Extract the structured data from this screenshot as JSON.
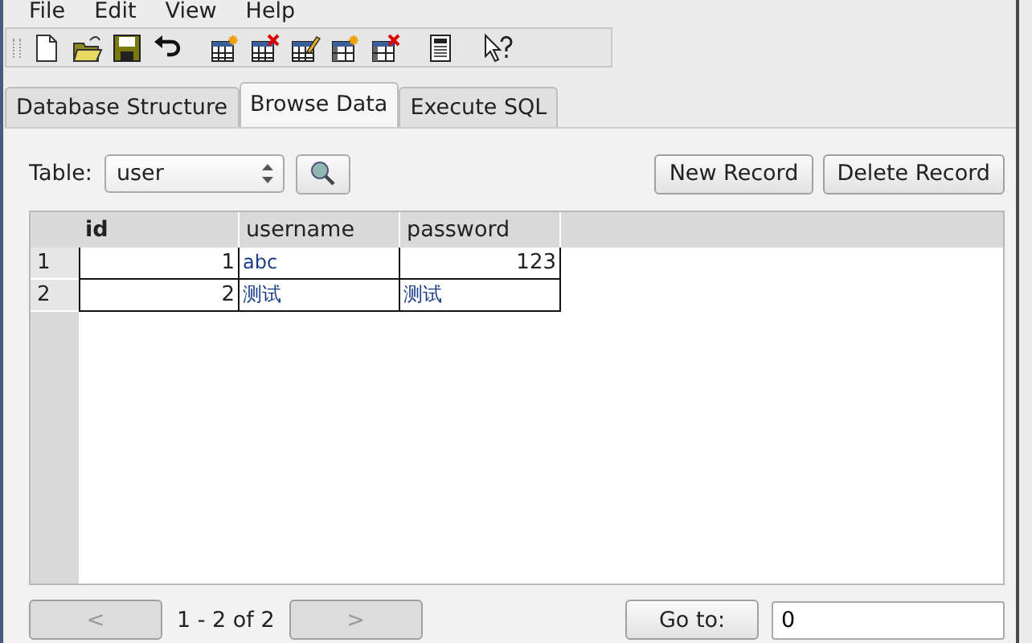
{
  "menu": [
    {
      "label": "File"
    },
    {
      "label": "Edit"
    },
    {
      "label": "View"
    },
    {
      "label": "Help"
    }
  ],
  "tabs": [
    {
      "label": "Database Structure",
      "selected": false
    },
    {
      "label": "Browse Data",
      "selected": true
    },
    {
      "label": "Execute SQL",
      "selected": false
    }
  ],
  "table_picker": {
    "label": "Table:",
    "value": "user"
  },
  "buttons": [
    "New Record",
    "Delete Record"
  ],
  "grid": {
    "columns": [
      "id",
      "username",
      "password"
    ],
    "rows": [
      {
        "header": "1",
        "cells": [
          {
            "text": "1",
            "kind": "number"
          },
          {
            "text": "abc",
            "kind": "text"
          },
          {
            "text": "123",
            "kind": "number"
          }
        ]
      },
      {
        "header": "2",
        "cells": [
          {
            "text": "2",
            "kind": "number"
          },
          {
            "text": "测试",
            "kind": "text"
          },
          {
            "text": "测试",
            "kind": "text"
          }
        ]
      }
    ]
  },
  "pager": {
    "previous": {
      "label": "<",
      "disabled": true
    },
    "range": "1 - 2 of 2",
    "next": {
      "label": ">",
      "disabled": true
    },
    "goto_button": "Go to:",
    "goto_value": "0"
  }
}
